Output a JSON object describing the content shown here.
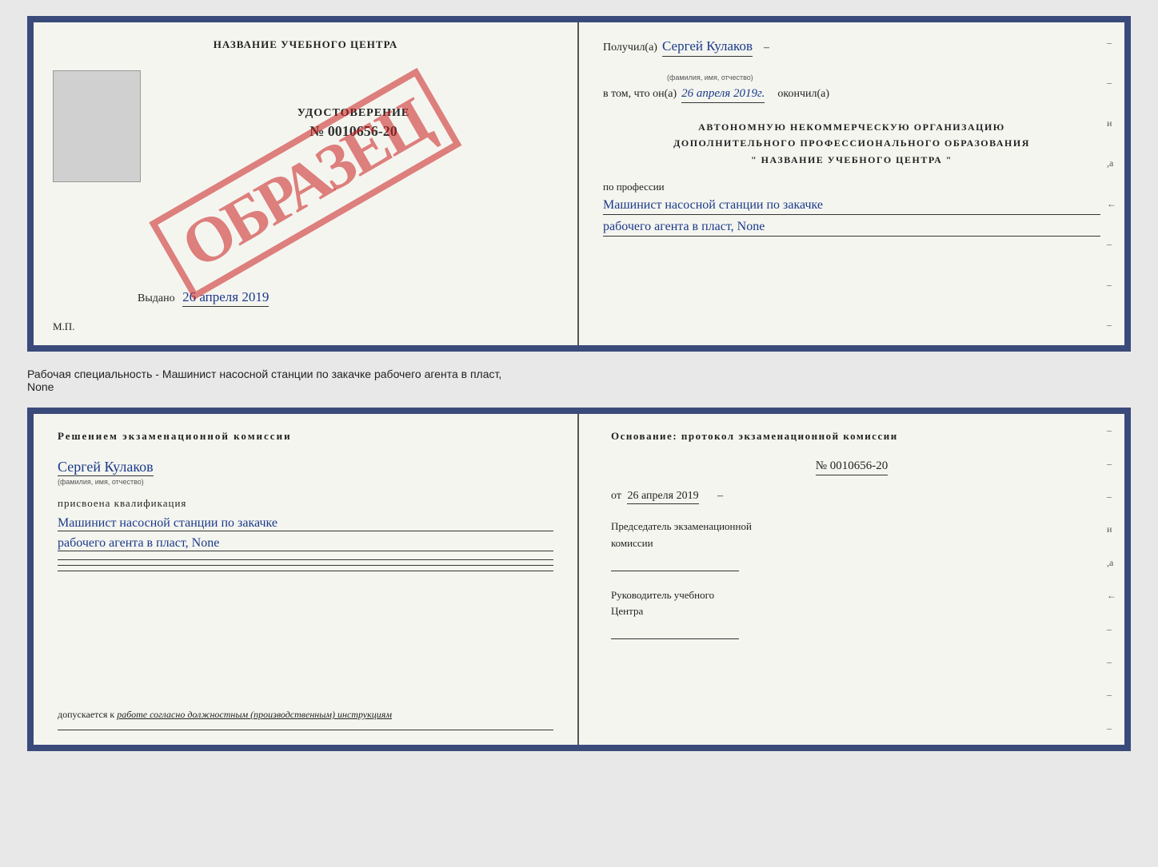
{
  "top_doc": {
    "left": {
      "center_title": "НАЗВАНИЕ УЧЕБНОГО ЦЕНТРА",
      "photo_alt": "photo",
      "udostoverenie": "УДОСТОВЕРЕНИЕ",
      "number": "№ 0010656-20",
      "vydano": "Выдано",
      "vydano_date": "26 апреля 2019",
      "mp": "М.П.",
      "obrazets": "ОБРАЗЕЦ"
    },
    "right": {
      "poluchil_label": "Получил(а)",
      "poluchil_name": "Сергей Кулаков",
      "fio_hint": "(фамилия, имя, отчество)",
      "v_tom_label": "в том, что он(а)",
      "date": "26 апреля 2019г.",
      "okonchil": "окончил(а)",
      "org_line1": "АВТОНОМНУЮ НЕКОММЕРЧЕСКУЮ ОРГАНИЗАЦИЮ",
      "org_line2": "ДОПОЛНИТЕЛЬНОГО ПРОФЕССИОНАЛЬНОГО ОБРАЗОВАНИЯ",
      "org_line3": "\"   НАЗВАНИЕ УЧЕБНОГО ЦЕНТРА   \"",
      "po_professii": "по профессии",
      "profession_line1": "Машинист насосной станции по закачке",
      "profession_line2": "рабочего агента в пласт, None"
    }
  },
  "between": {
    "text_line1": "Рабочая специальность - Машинист насосной станции по закачке рабочего агента в пласт,",
    "text_line2": "None"
  },
  "bottom_doc": {
    "left": {
      "resheniem": "Решением  экзаменационной  комиссии",
      "name": "Сергей Кулаков",
      "fio_hint": "(фамилия, имя, отчество)",
      "prisvoena": "присвоена квалификация",
      "qual_line1": "Машинист насосной станции по закачке",
      "qual_line2": "рабочего агента в пласт, None",
      "dopuskaetsya": "допускается к",
      "dopuskaetsya_rest": "работе согласно должностным (производственным) инструкциям"
    },
    "right": {
      "osnovanie": "Основание: протокол экзаменационной  комиссии",
      "number": "№  0010656-20",
      "ot": "от",
      "date": "26 апреля 2019",
      "predsedatel_label": "Председатель экзаменационной",
      "predsedatel_label2": "комиссии",
      "rukovoditel_label": "Руководитель учебного",
      "rukovoditel_label2": "Центра"
    }
  }
}
